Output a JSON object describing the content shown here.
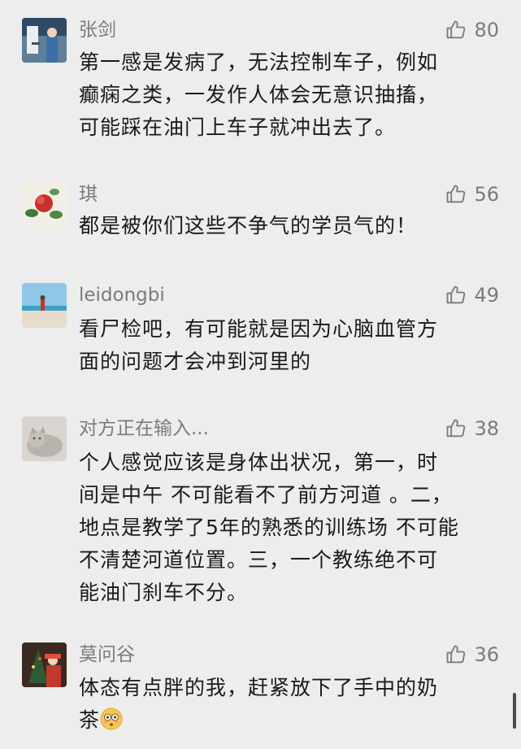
{
  "comments": [
    {
      "name": "张剑",
      "likes": "80",
      "lines": [
        "第一感是发病了，无法控制车子，例如",
        "癫痫之类，一发作人体会无意识抽搐，",
        "可能踩在油门上车子就冲出去了。"
      ]
    },
    {
      "name": "琪",
      "likes": "56",
      "lines": [
        "都是被你们这些不争气的学员气的！"
      ]
    },
    {
      "name": "leidongbi",
      "likes": "49",
      "lines": [
        "看尸检吧，有可能就是因为心脑血管方",
        "面的问题才会冲到河里的"
      ]
    },
    {
      "name": "对方正在输入...",
      "likes": "38",
      "lines": [
        "个人感觉应该是身体出状况，第一，时",
        "间是中午 不可能看不了前方河道 。二，",
        "地点是教学了5年的熟悉的训练场 不可能",
        "不清楚河道位置。三，一个教练绝不可",
        "能油门刹车不分。"
      ]
    },
    {
      "name": "莫问谷",
      "likes": "36",
      "lines": [
        "体态有点胖的我，赶紧放下了手中的奶",
        "茶"
      ]
    }
  ],
  "icons": {
    "like": "thumbs-up-outline-icon",
    "emoji": "flushed-face-emoji"
  },
  "colors": {
    "background": "#ededed",
    "name": "#7b7b7b",
    "text": "#1a1a1a"
  }
}
